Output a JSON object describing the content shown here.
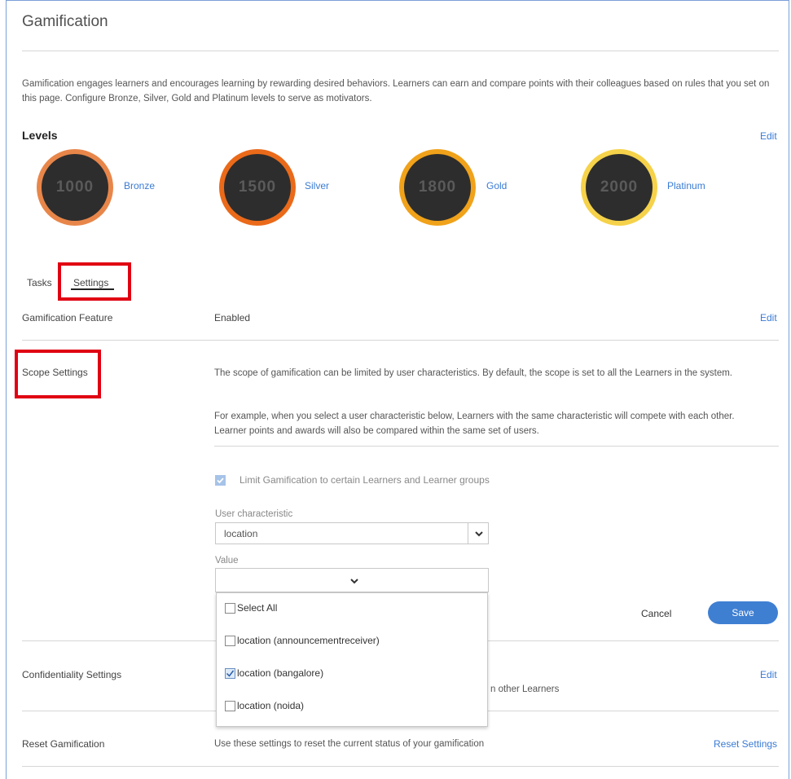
{
  "page": {
    "title": "Gamification"
  },
  "description": "Gamification engages learners and encourages learning by rewarding desired behaviors. Learners can earn and compare points with their colleagues based on rules that you set on this page. Configure Bronze, Silver, Gold and Platinum levels to serve as motivators.",
  "levels": {
    "label": "Levels",
    "edit_label": "Edit",
    "items": [
      {
        "points": "1000",
        "name": "Bronze",
        "color": "#e8864a"
      },
      {
        "points": "1500",
        "name": "Silver",
        "color": "#ea6a1a"
      },
      {
        "points": "1800",
        "name": "Gold",
        "color": "#f0a21a"
      },
      {
        "points": "2000",
        "name": "Platinum",
        "color": "#f5d24a"
      }
    ]
  },
  "tabs": {
    "tasks": "Tasks",
    "settings": "Settings"
  },
  "feature": {
    "label": "Gamification Feature",
    "value": "Enabled",
    "edit_label": "Edit"
  },
  "scope": {
    "label": "Scope Settings",
    "text1": "The scope of gamification can be limited by user characteristics. By default, the scope is set to all the Learners in the system.",
    "text2": "For example, when you select a user characteristic below, Learners with the same characteristic will compete with each other. Learner points and awards will also be compared within the same set of users.",
    "limit_label": "Limit Gamification to certain Learners and Learner groups",
    "limit_checked": true,
    "characteristic_label": "User characteristic",
    "characteristic_value": "location",
    "value_label": "Value",
    "value_value": "",
    "options": [
      {
        "label": "Select All",
        "checked": false
      },
      {
        "label": "location (announcementreceiver)",
        "checked": false
      },
      {
        "label": "location (bangalore)",
        "checked": true
      },
      {
        "label": "location (noida)",
        "checked": false
      }
    ],
    "cancel_label": "Cancel",
    "save_label": "Save"
  },
  "confidentiality": {
    "label": "Confidentiality Settings",
    "partial_text": "n other Learners",
    "edit_label": "Edit"
  },
  "reset": {
    "label": "Reset Gamification",
    "text": "Use these settings to reset the current status of your gamification",
    "link_label": "Reset Settings"
  },
  "colors": {
    "accent": "#3a7bd5",
    "highlight": "#e00012"
  }
}
